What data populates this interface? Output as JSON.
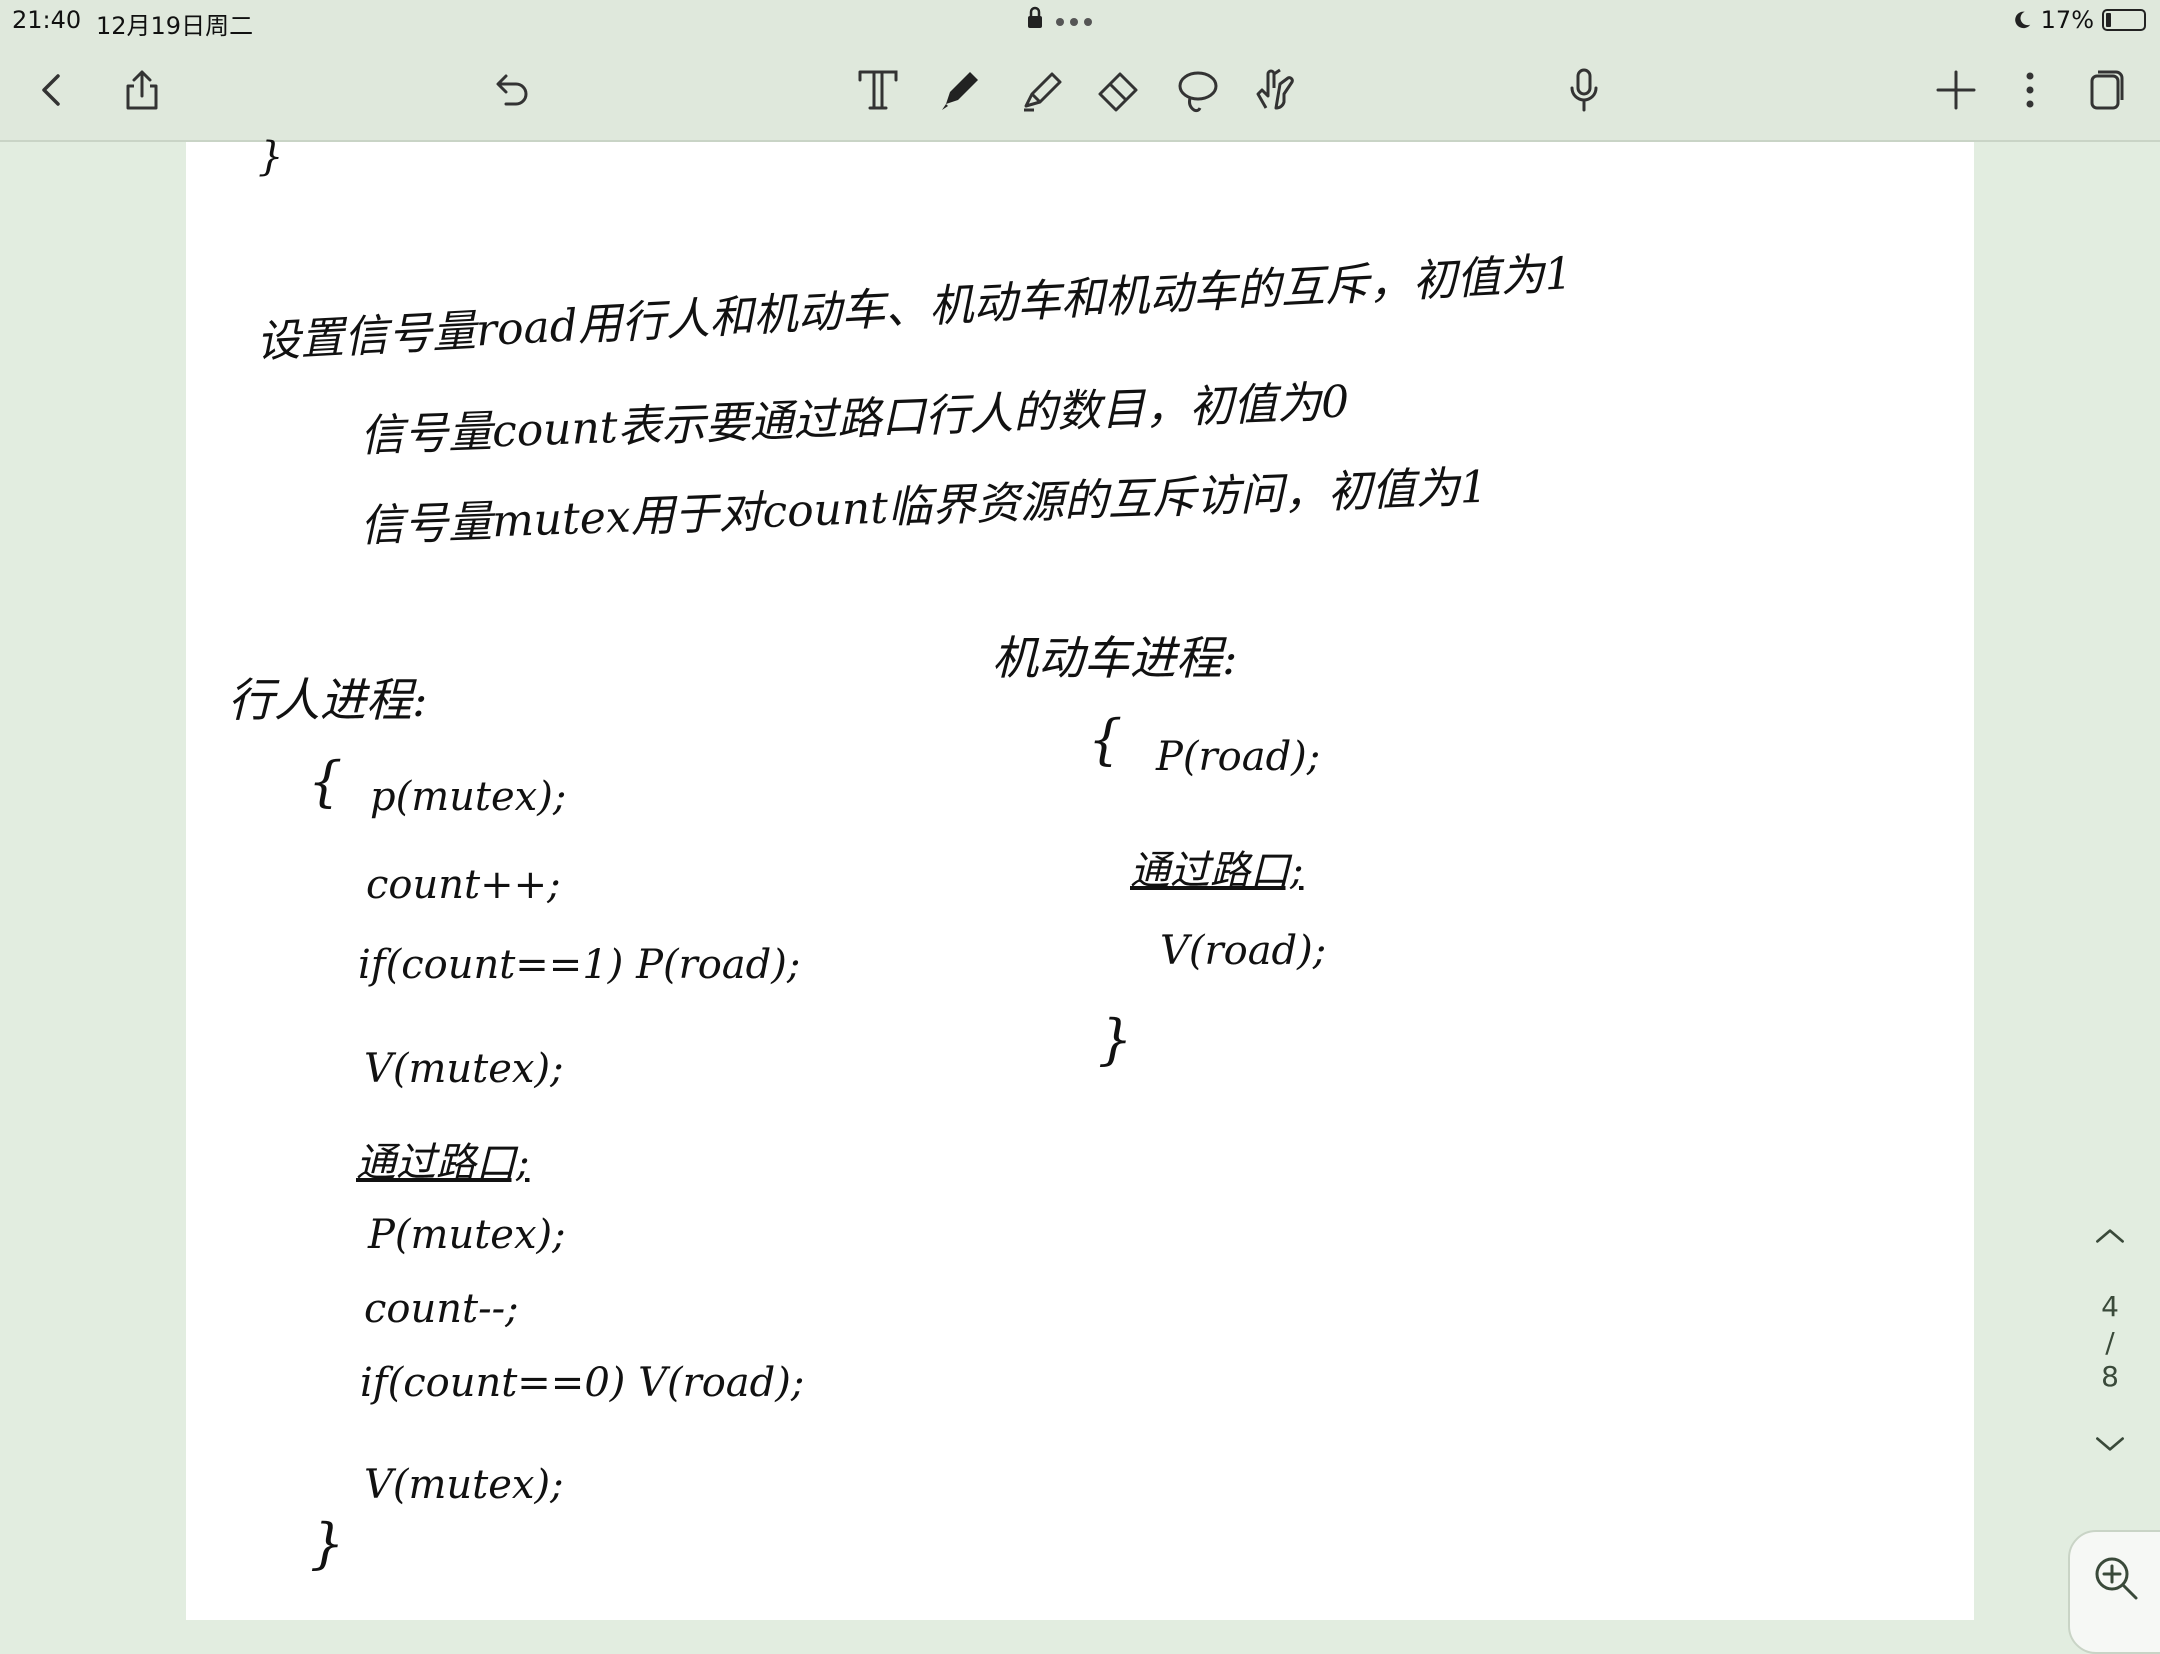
{
  "status_bar": {
    "time": "21:40",
    "date": "12月19日周二",
    "battery": "17%"
  },
  "toolbar": {
    "back": "chevron-left-icon",
    "share": "share-icon",
    "undo": "undo-icon",
    "text_tool": "text-tool-icon",
    "pen_tool": "pen-icon",
    "highlighter_tool": "highlighter-icon",
    "eraser_tool": "eraser-icon",
    "lasso_tool": "lasso-icon",
    "hand_tool": "hand-icon",
    "mic": "microphone-icon",
    "add": "plus-icon",
    "more": "more-vertical-icon",
    "pages": "pages-icon"
  },
  "note": {
    "stray_mark": "}",
    "definitions": [
      "设置信号量road用行人和机动车、机动车和机动车的互斥，初值为1",
      "信号量count表示要通过路口行人的数目，初值为0",
      "信号量mutex用于对count临界资源的互斥访问，初值为1"
    ],
    "pedestrian": {
      "title": "行人进程:",
      "open": "{",
      "lines": [
        "p(mutex);",
        "count++;",
        "if(count==1)  P(road);",
        "V(mutex);",
        "通过路口;",
        "P(mutex);",
        "count--;",
        "if(count==0)  V(road);",
        "V(mutex);"
      ],
      "close": "}"
    },
    "vehicle": {
      "title": "机动车进程:",
      "open": "{",
      "lines": [
        "P(road);",
        "通过路口;",
        "V(road);"
      ],
      "close": "}"
    }
  },
  "pager": {
    "current": "4",
    "separator": "/",
    "total": "8"
  },
  "colors": {
    "toolbar_bg": "#dfe8dc",
    "canvas_bg": "#e2ede0",
    "page_bg": "#ffffff",
    "ink": "#111111"
  }
}
